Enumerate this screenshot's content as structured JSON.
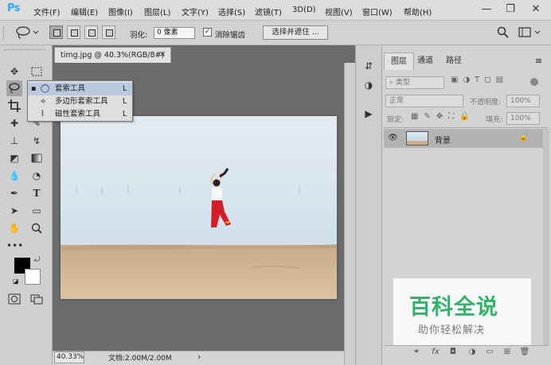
{
  "app": {
    "logo": "Ps"
  },
  "menu": [
    "文件(F)",
    "编辑(E)",
    "图像(I)",
    "图层(L)",
    "文字(Y)",
    "选择(S)",
    "滤镜(T)",
    "3D(D)",
    "视图(V)",
    "窗口(W)",
    "帮助(H)"
  ],
  "window_controls": {
    "minimize": "—",
    "restore": "❐",
    "close": "✕"
  },
  "options": {
    "feather_label": "羽化:",
    "feather_value": "0 像素",
    "antialias_checked": true,
    "antialias_label": "消除锯齿",
    "select_mask_label": "选择并遮住 ..."
  },
  "document": {
    "tab_title": "timg.jpg @ 40.3%(RGB/8#)",
    "tab_close": "×",
    "zoom": "40.33%",
    "doc_info": "文档:2.00M/2.00M",
    "status_arrow": "›"
  },
  "flyout": {
    "items": [
      {
        "label": "套索工具",
        "shortcut": "L",
        "active": true,
        "icon": "lasso-icon"
      },
      {
        "label": "多边形套索工具",
        "shortcut": "L",
        "active": false,
        "icon": "polygonal-lasso-icon"
      },
      {
        "label": "磁性套索工具",
        "shortcut": "L",
        "active": false,
        "icon": "magnetic-lasso-icon"
      }
    ]
  },
  "layers_panel": {
    "tabs": [
      "图层",
      "通道",
      "路径"
    ],
    "filter_kind": "类型",
    "blend_mode": "正常",
    "opacity_label": "不透明度:",
    "opacity_value": "100%",
    "lock_label": "锁定:",
    "fill_label": "填充:",
    "fill_value": "100%",
    "layers": [
      {
        "name": "背景",
        "visible": true,
        "locked": true
      }
    ]
  },
  "watermark": {
    "title": "百科全说",
    "subtitle": "助你轻松解决"
  },
  "colors": {
    "foreground": "#000000",
    "background": "#ffffff",
    "accent": "#31a8ff",
    "watermark_green": "#33b26b"
  }
}
